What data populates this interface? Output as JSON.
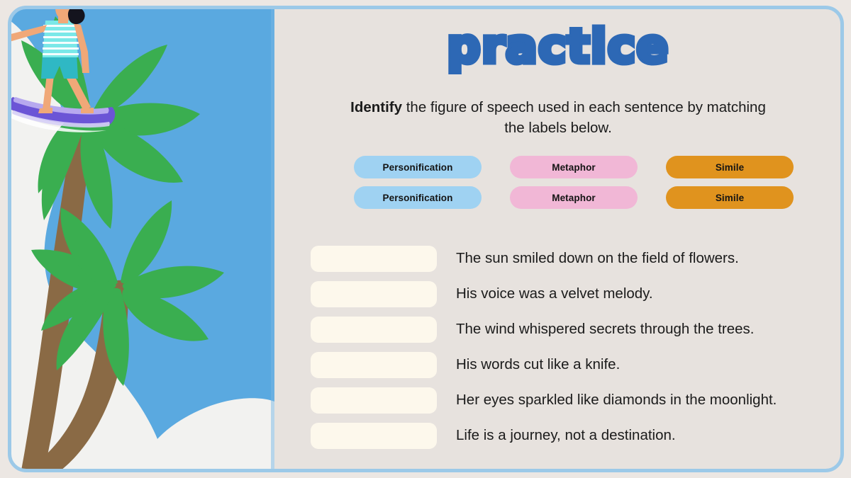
{
  "slide": {
    "title": "practice",
    "subtitle_bold": "Identify",
    "subtitle_rest": " the figure of speech used in each sentence by matching the labels below."
  },
  "colors": {
    "frame_border": "#9cc9e8",
    "page_background": "#ece7e3",
    "panel_background": "#e7e2de",
    "sky": "#5aa9e0",
    "wave_white": "#f2f2f0",
    "palm_green": "#3aae50",
    "palm_trunk": "#8a6a45",
    "title_blue": "#2d68b5",
    "pill_personification": "#9fd2f2",
    "pill_metaphor": "#f1b7d6",
    "pill_simile": "#e0931e",
    "blank_box": "#fdf8ec",
    "body_text": "#1b1b1b",
    "surfboard_purple": "#6b55d6",
    "skin": "#f0a878",
    "hair": "#14141e",
    "swimsuit_teal": "#3fc8d0"
  },
  "labels": {
    "rows": [
      [
        {
          "text": "Personification",
          "variant": "personification"
        },
        {
          "text": "Metaphor",
          "variant": "metaphor"
        },
        {
          "text": "Simile",
          "variant": "simile"
        }
      ],
      [
        {
          "text": "Personification",
          "variant": "personification"
        },
        {
          "text": "Metaphor",
          "variant": "metaphor"
        },
        {
          "text": "Simile",
          "variant": "simile"
        }
      ]
    ]
  },
  "sentences": [
    {
      "blank_value": "",
      "text": "The sun smiled down on the field of flowers."
    },
    {
      "blank_value": "",
      "text": "His voice was a velvet melody."
    },
    {
      "blank_value": "",
      "text": "The wind whispered secrets through the trees."
    },
    {
      "blank_value": "",
      "text": "His words cut like a knife."
    },
    {
      "blank_value": "",
      "text": "Her eyes sparkled like diamonds in the moonlight."
    },
    {
      "blank_value": "",
      "text": "Life is a journey, not a destination."
    }
  ],
  "illustration": {
    "name": "beach-surfer-palm-trees",
    "elements": [
      "sky",
      "white-wave",
      "palm-tree-upper",
      "palm-tree-lower",
      "surfer-on-surfboard"
    ]
  }
}
